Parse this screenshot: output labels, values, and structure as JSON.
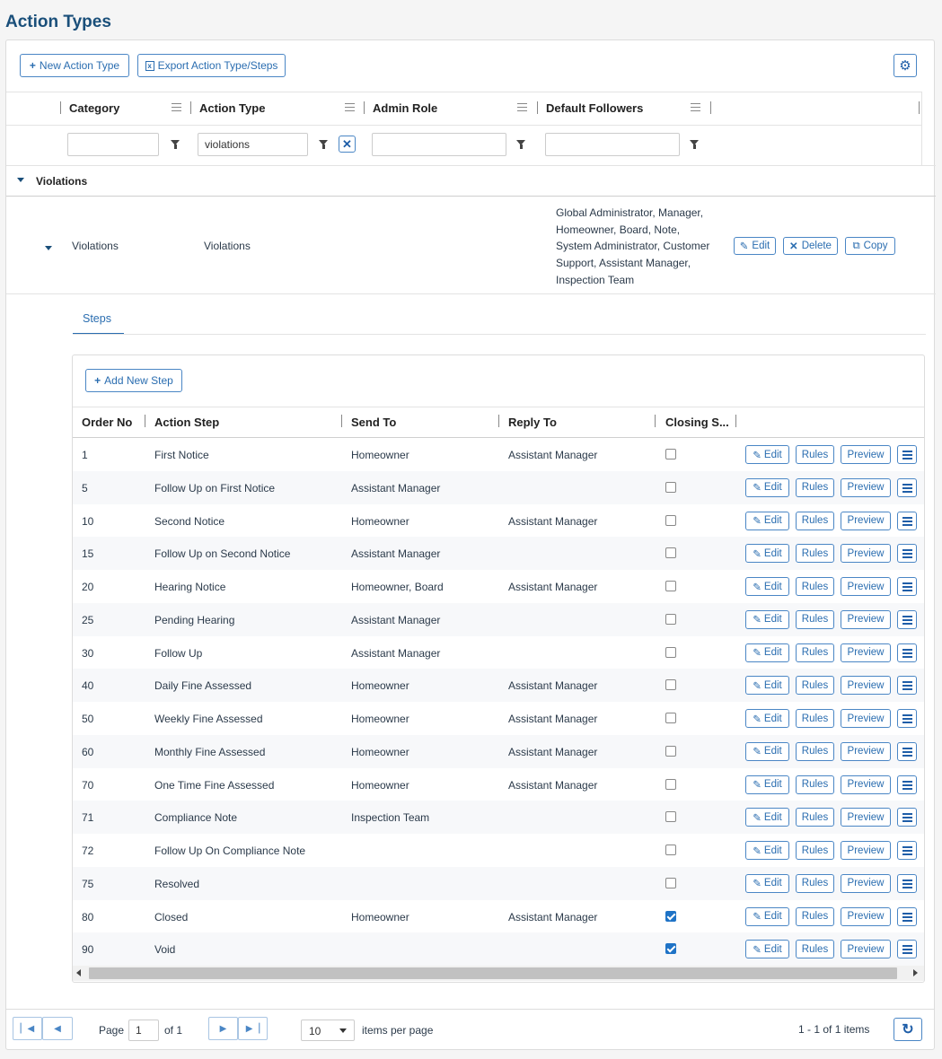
{
  "page": {
    "title": "Action Types"
  },
  "toolbar": {
    "new_label": "New Action Type",
    "export_label": "Export Action Type/Steps"
  },
  "columns": {
    "category": "Category",
    "action_type": "Action Type",
    "admin_role": "Admin Role",
    "default_followers": "Default Followers"
  },
  "filters": {
    "category": "",
    "action_type": "violations",
    "admin_role": "",
    "default_followers": ""
  },
  "group": {
    "label": "Violations"
  },
  "record": {
    "category": "Violations",
    "action_type": "Violations",
    "followers_lines": [
      "Global Administrator, Manager,",
      "Homeowner, Board, Note,",
      "System Administrator, Customer",
      "Support, Assistant Manager,",
      "Inspection Team"
    ],
    "edit_label": "Edit",
    "delete_label": "Delete",
    "copy_label": "Copy"
  },
  "steps_tab": {
    "label": "Steps"
  },
  "steps": {
    "add_label": "Add New Step",
    "headers": {
      "order": "Order No",
      "step": "Action Step",
      "send": "Send To",
      "reply": "Reply To",
      "closing": "Closing S..."
    },
    "row_buttons": {
      "edit": "Edit",
      "rules": "Rules",
      "preview": "Preview"
    },
    "rows": [
      {
        "order": "1",
        "step": "First Notice",
        "send": "Homeowner",
        "reply": "Assistant Manager",
        "closing": false
      },
      {
        "order": "5",
        "step": "Follow Up on First Notice",
        "send": "Assistant Manager",
        "reply": "",
        "closing": false
      },
      {
        "order": "10",
        "step": "Second Notice",
        "send": "Homeowner",
        "reply": "Assistant Manager",
        "closing": false
      },
      {
        "order": "15",
        "step": "Follow Up on Second Notice",
        "send": "Assistant Manager",
        "reply": "",
        "closing": false
      },
      {
        "order": "20",
        "step": "Hearing Notice",
        "send": "Homeowner, Board",
        "reply": "Assistant Manager",
        "closing": false
      },
      {
        "order": "25",
        "step": "Pending Hearing",
        "send": "Assistant Manager",
        "reply": "",
        "closing": false
      },
      {
        "order": "30",
        "step": "Follow Up",
        "send": "Assistant Manager",
        "reply": "",
        "closing": false
      },
      {
        "order": "40",
        "step": "Daily Fine Assessed",
        "send": "Homeowner",
        "reply": "Assistant Manager",
        "closing": false
      },
      {
        "order": "50",
        "step": "Weekly Fine Assessed",
        "send": "Homeowner",
        "reply": "Assistant Manager",
        "closing": false
      },
      {
        "order": "60",
        "step": "Monthly Fine Assessed",
        "send": "Homeowner",
        "reply": "Assistant Manager",
        "closing": false
      },
      {
        "order": "70",
        "step": "One Time Fine Assessed",
        "send": "Homeowner",
        "reply": "Assistant Manager",
        "closing": false
      },
      {
        "order": "71",
        "step": "Compliance Note",
        "send": "Inspection Team",
        "reply": "",
        "closing": false
      },
      {
        "order": "72",
        "step": "Follow Up On Compliance Note",
        "send": "",
        "reply": "",
        "closing": false
      },
      {
        "order": "75",
        "step": "Resolved",
        "send": "",
        "reply": "",
        "closing": false
      },
      {
        "order": "80",
        "step": "Closed",
        "send": "Homeowner",
        "reply": "Assistant Manager",
        "closing": true
      },
      {
        "order": "90",
        "step": "Void",
        "send": "",
        "reply": "",
        "closing": true
      }
    ]
  },
  "pager": {
    "page_label": "Page",
    "page_value": "1",
    "of_label": "of 1",
    "page_size": "10",
    "items_per_page": "items per page",
    "summary": "1 - 1 of 1 items"
  },
  "icons": [
    "plus-icon",
    "excel-icon",
    "gear-icon",
    "menu-icon",
    "filter-icon",
    "clear-icon",
    "caret-down-icon",
    "pencil-icon",
    "close-icon",
    "copy-icon",
    "hamburger-icon",
    "first-page-icon",
    "prev-page-icon",
    "next-page-icon",
    "last-page-icon",
    "refresh-icon"
  ],
  "colors": {
    "accent": "#2a6db0",
    "title": "#1a4f7a",
    "checked": "#1f73c6"
  }
}
